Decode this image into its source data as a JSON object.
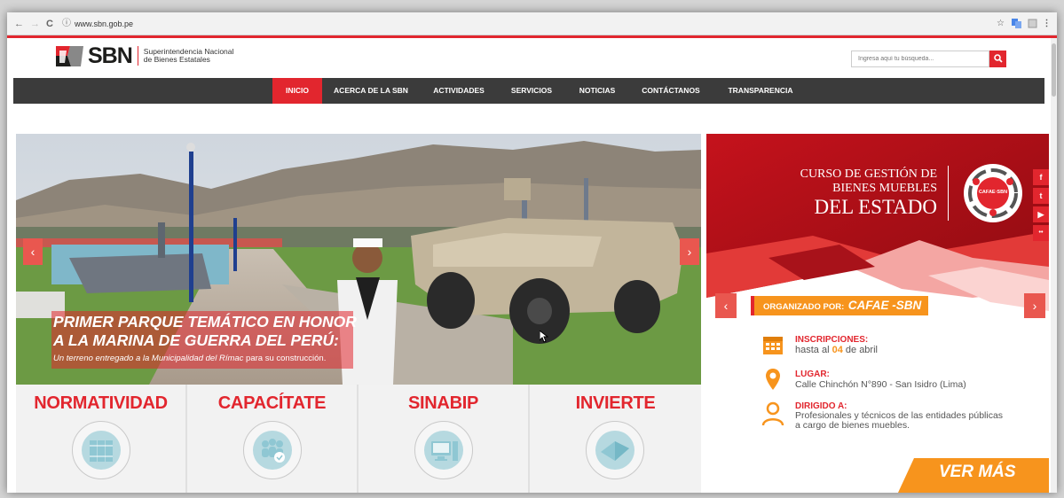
{
  "browser": {
    "url": "www.sbn.gob.pe",
    "nav_back": "←",
    "nav_fwd": "→",
    "reload": "C",
    "info": "ⓘ",
    "star": "☆",
    "more": "⋮"
  },
  "header": {
    "logo_text": "SBN",
    "logo_sub_1": "Superintendencia Nacional",
    "logo_sub_2": "de  Bienes  Estatales",
    "search_placeholder": "Ingresa aquí tu búsqueda..."
  },
  "nav": {
    "items": [
      "INICIO",
      "ACERCA DE LA SBN",
      "ACTIVIDADES",
      "SERVICIOS",
      "NOTICIAS",
      "CONTÁCTANOS",
      "TRANSPARENCIA"
    ]
  },
  "hero": {
    "headline_1": "PRIMER PARQUE TEMÁTICO EN HONOR",
    "headline_2": "A LA MARINA DE GUERRA DEL PERÚ:",
    "caption_italic": "Un terreno entregado a la Municipalidad del Rímac",
    "caption_tail": " para su construcción."
  },
  "banner": {
    "title_1": "CURSO DE GESTIÓN DE",
    "title_2": "BIENES MUEBLES",
    "title_3": "DEL ESTADO",
    "badge_text": "CAFAE·SBN",
    "org_label": "ORGANIZADO POR:",
    "org_name": "CAFAE -SBN",
    "insc_label": "INSCRIPCIONES:",
    "insc_pre": "hasta al ",
    "insc_num": "04",
    "insc_post": " de abril",
    "lugar_label": "LUGAR:",
    "lugar_text": "Calle Chinchón N°890 - San Isidro (Lima)",
    "dir_label": "DIRIGIDO A:",
    "dir_text_1": "Profesionales y técnicos de las entidades públicas",
    "dir_text_2": "a cargo de bienes muebles.",
    "cta": "VER MÁS"
  },
  "social": [
    "f",
    "t",
    "▶",
    "••"
  ],
  "cards": [
    "NORMATIVIDAD",
    "CAPACÍTATE",
    "SINABIP",
    "INVIERTE"
  ],
  "colors": {
    "brand_red": "#e2262e",
    "nav_dark": "#3b3b3b",
    "orange": "#f7941d"
  }
}
